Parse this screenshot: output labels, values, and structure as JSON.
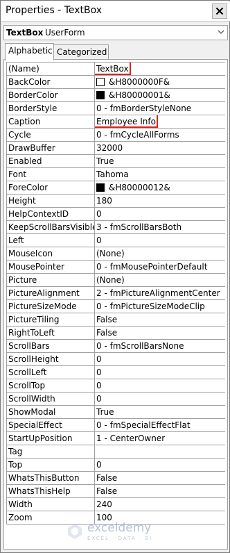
{
  "window": {
    "title": "Properties - TextBox"
  },
  "object_selector": {
    "name": "TextBox",
    "type": "UserForm"
  },
  "tabs": [
    {
      "label": "Alphabetic",
      "active": true
    },
    {
      "label": "Categorized",
      "active": false
    }
  ],
  "properties": [
    {
      "name": "(Name)",
      "value": "TextBox",
      "highlighted": true
    },
    {
      "name": "BackColor",
      "value": "&H8000000F&",
      "swatch": "#ffffff"
    },
    {
      "name": "BorderColor",
      "value": "&H80000001&",
      "swatch": "#000000"
    },
    {
      "name": "BorderStyle",
      "value": "0 - fmBorderStyleNone"
    },
    {
      "name": "Caption",
      "value": "Employee Info",
      "highlighted": true
    },
    {
      "name": "Cycle",
      "value": "0 - fmCycleAllForms"
    },
    {
      "name": "DrawBuffer",
      "value": "32000"
    },
    {
      "name": "Enabled",
      "value": "True"
    },
    {
      "name": "Font",
      "value": "Tahoma"
    },
    {
      "name": "ForeColor",
      "value": "&H80000012&",
      "swatch": "#000000"
    },
    {
      "name": "Height",
      "value": "180"
    },
    {
      "name": "HelpContextID",
      "value": "0"
    },
    {
      "name": "KeepScrollBarsVisible",
      "value": "3 - fmScrollBarsBoth"
    },
    {
      "name": "Left",
      "value": "0"
    },
    {
      "name": "MouseIcon",
      "value": "(None)"
    },
    {
      "name": "MousePointer",
      "value": "0 - fmMousePointerDefault"
    },
    {
      "name": "Picture",
      "value": "(None)"
    },
    {
      "name": "PictureAlignment",
      "value": "2 - fmPictureAlignmentCenter"
    },
    {
      "name": "PictureSizeMode",
      "value": "0 - fmPictureSizeModeClip"
    },
    {
      "name": "PictureTiling",
      "value": "False"
    },
    {
      "name": "RightToLeft",
      "value": "False"
    },
    {
      "name": "ScrollBars",
      "value": "0 - fmScrollBarsNone"
    },
    {
      "name": "ScrollHeight",
      "value": "0"
    },
    {
      "name": "ScrollLeft",
      "value": "0"
    },
    {
      "name": "ScrollTop",
      "value": "0"
    },
    {
      "name": "ScrollWidth",
      "value": "0"
    },
    {
      "name": "ShowModal",
      "value": "True"
    },
    {
      "name": "SpecialEffect",
      "value": "0 - fmSpecialEffectFlat"
    },
    {
      "name": "StartUpPosition",
      "value": "1 - CenterOwner"
    },
    {
      "name": "Tag",
      "value": ""
    },
    {
      "name": "Top",
      "value": "0"
    },
    {
      "name": "WhatsThisButton",
      "value": "False"
    },
    {
      "name": "WhatsThisHelp",
      "value": "False"
    },
    {
      "name": "Width",
      "value": "240"
    },
    {
      "name": "Zoom",
      "value": "100"
    }
  ],
  "watermark": {
    "brand": "exceldemy",
    "tagline": "EXCEL · DATA · BI"
  },
  "colors": {
    "highlight": "#e0201e",
    "grid_line": "#a0a0a0"
  }
}
